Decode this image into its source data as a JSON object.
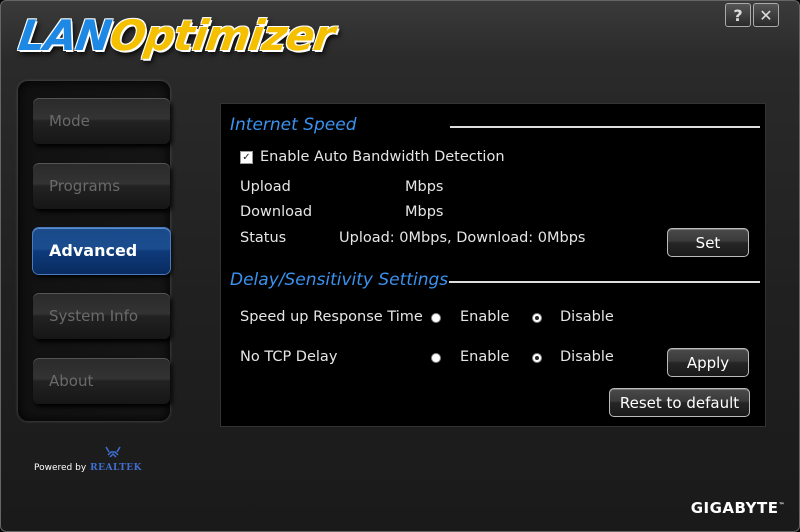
{
  "app": {
    "logo_part1": "LAN",
    "logo_part2": "Optimizer",
    "help_label": "?",
    "close_label": "✕",
    "powered_by": "Powered by",
    "realtek": "REALTEK",
    "brand": "GIGABYTE"
  },
  "sidebar": {
    "items": [
      {
        "label": "Mode",
        "active": false
      },
      {
        "label": "Programs",
        "active": false
      },
      {
        "label": "Advanced",
        "active": true
      },
      {
        "label": "System Info",
        "active": false
      },
      {
        "label": "About",
        "active": false
      }
    ]
  },
  "internet_speed": {
    "title": "Internet Speed",
    "auto_detect_label": "Enable Auto Bandwidth Detection",
    "auto_detect_checked": true,
    "upload_label": "Upload",
    "upload_unit": "Mbps",
    "download_label": "Download",
    "download_unit": "Mbps",
    "status_label": "Status",
    "status_value": "Upload: 0Mbps, Download: 0Mbps",
    "set_button": "Set"
  },
  "delay": {
    "title": "Delay/Sensitivity Settings",
    "response_label": "Speed up Response Time",
    "tcp_label": "No TCP Delay",
    "enable_label": "Enable",
    "disable_label": "Disable",
    "response_selected": "Disable",
    "tcp_selected": "Disable",
    "apply_button": "Apply",
    "reset_button": "Reset to default"
  },
  "colors": {
    "accent": "#3a92ee",
    "active_nav": "#1b4c8f",
    "logo_blue": "#1e88e5",
    "logo_yellow": "#f5c000"
  }
}
